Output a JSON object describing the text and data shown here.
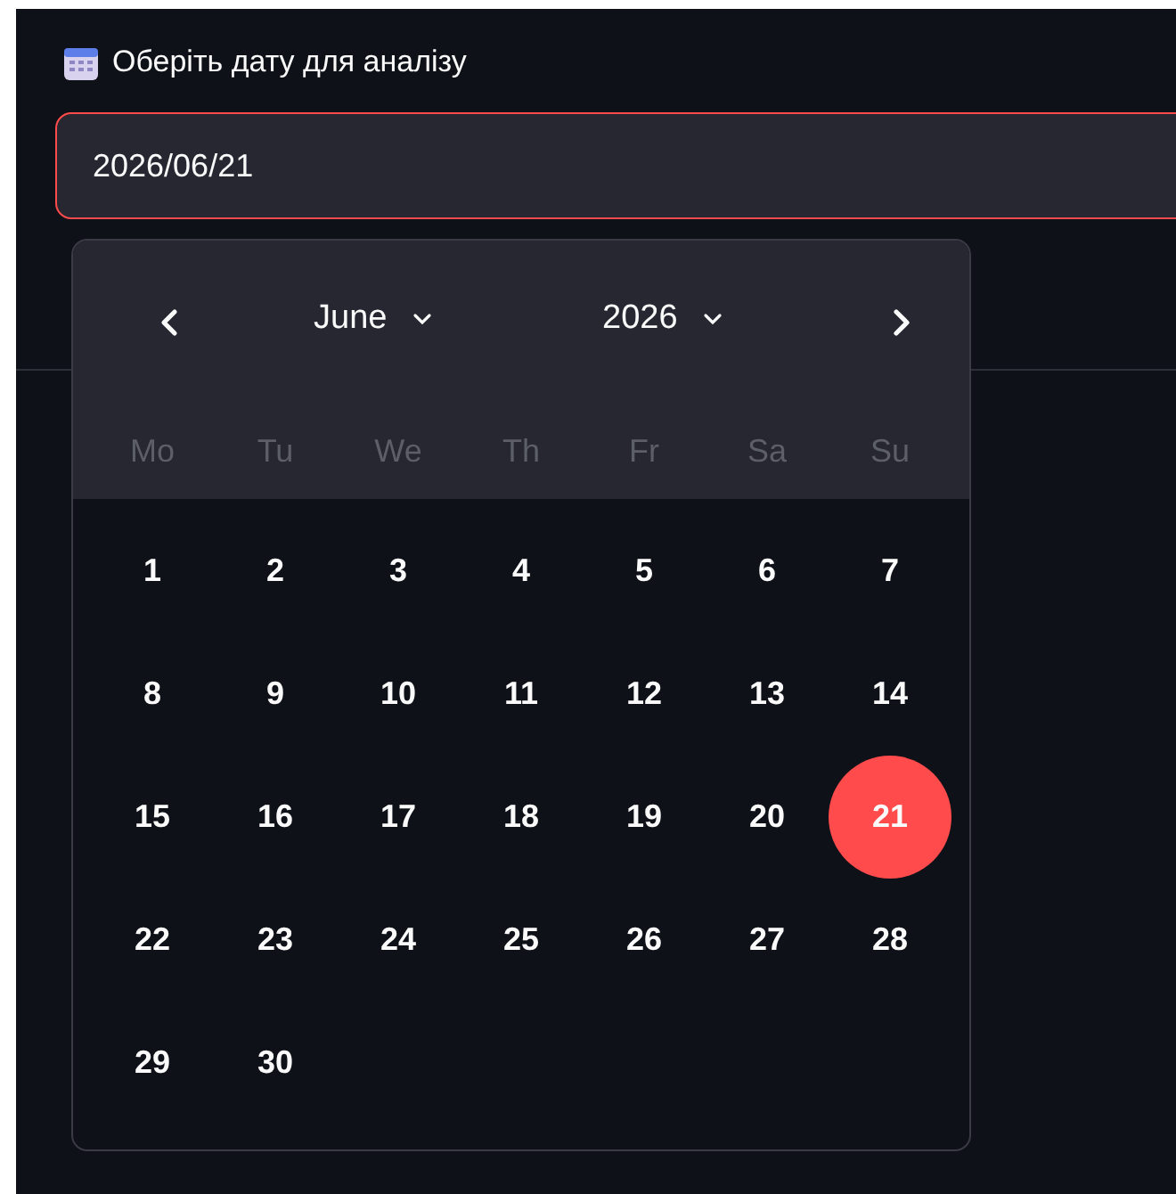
{
  "field": {
    "label": "Оберіть дату для аналізу",
    "value": "2026/06/21",
    "focused": true
  },
  "calendar": {
    "month": "June",
    "year": "2026",
    "weekdays": [
      "Mo",
      "Tu",
      "We",
      "Th",
      "Fr",
      "Sa",
      "Su"
    ],
    "weeks": [
      [
        {
          "day": "1",
          "selected": false
        },
        {
          "day": "2",
          "selected": false
        },
        {
          "day": "3",
          "selected": false
        },
        {
          "day": "4",
          "selected": false
        },
        {
          "day": "5",
          "selected": false
        },
        {
          "day": "6",
          "selected": false
        },
        {
          "day": "7",
          "selected": false
        }
      ],
      [
        {
          "day": "8",
          "selected": false
        },
        {
          "day": "9",
          "selected": false
        },
        {
          "day": "10",
          "selected": false
        },
        {
          "day": "11",
          "selected": false
        },
        {
          "day": "12",
          "selected": false
        },
        {
          "day": "13",
          "selected": false
        },
        {
          "day": "14",
          "selected": false
        }
      ],
      [
        {
          "day": "15",
          "selected": false
        },
        {
          "day": "16",
          "selected": false
        },
        {
          "day": "17",
          "selected": false
        },
        {
          "day": "18",
          "selected": false
        },
        {
          "day": "19",
          "selected": false
        },
        {
          "day": "20",
          "selected": false
        },
        {
          "day": "21",
          "selected": true
        }
      ],
      [
        {
          "day": "22",
          "selected": false
        },
        {
          "day": "23",
          "selected": false
        },
        {
          "day": "24",
          "selected": false
        },
        {
          "day": "25",
          "selected": false
        },
        {
          "day": "26",
          "selected": false
        },
        {
          "day": "27",
          "selected": false
        },
        {
          "day": "28",
          "selected": false
        }
      ],
      [
        {
          "day": "29",
          "selected": false
        },
        {
          "day": "30",
          "selected": false
        }
      ]
    ]
  }
}
